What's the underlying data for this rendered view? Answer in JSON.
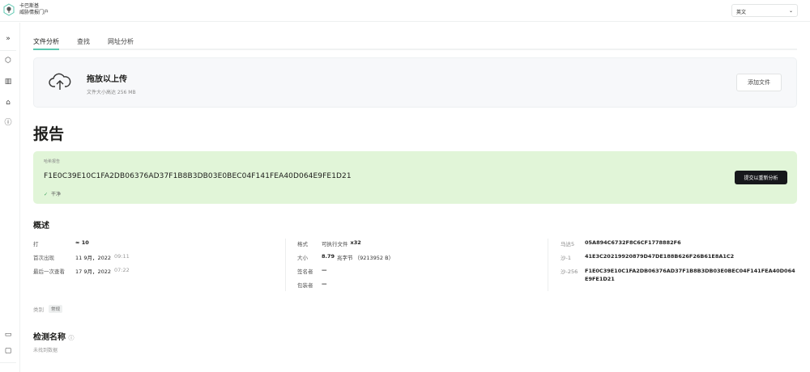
{
  "header": {
    "brand_line1": "卡巴斯基",
    "brand_line2": "威胁情报门户",
    "language": "英文"
  },
  "tabs": [
    {
      "label": "文件分析",
      "active": true
    },
    {
      "label": "查找"
    },
    {
      "label": "网址分析"
    }
  ],
  "upload": {
    "title": "拖放以上传",
    "subtitle": "文件大小高达 256 MB",
    "add_button": "添加文件"
  },
  "report": {
    "heading": "报告",
    "hash_label": "哈希报告",
    "hash": "F1E0C39E10C1FA2DB06376AD37F1B8B3DB03E0BEC04F141FEA40D064E9FE1D21",
    "status": "干净",
    "resubmit_button": "提交以重新分析",
    "status_color": "#3ca05a"
  },
  "overview": {
    "heading": "概述",
    "col1": [
      {
        "k": "打",
        "v": "≈ 10",
        "t": ""
      },
      {
        "k": "首次出现",
        "v": "11 9月，2022",
        "t": "09:11"
      },
      {
        "k": "最后一次查看",
        "v": "17 9月，2022",
        "t": "07:22"
      }
    ],
    "col2": [
      {
        "k": "格式",
        "pre": "可执行文件",
        "v": "x32"
      },
      {
        "k": "大小",
        "v": "8.79",
        "pre": "兆字节 （9213952 B）"
      },
      {
        "k": "签名者",
        "v": "—"
      },
      {
        "k": "包装者",
        "v": "—"
      }
    ],
    "col3": [
      {
        "k": "马达5",
        "v": "05A894C6732F8C6CF1778882F6"
      },
      {
        "k": "沙-1",
        "v": "41E3C20219920879D47DE188B626F26B61E8A1C2"
      },
      {
        "k": "沙-256",
        "v": "F1E0C39E10C1FA2DB06376AD37F1B8B3DB03E0BEC04F141FEA40D064",
        "v2": "E9FE1D21"
      }
    ],
    "category_label": "类别",
    "category": "常规"
  },
  "detection": {
    "heading": "检测名称",
    "empty": "未找到数据"
  }
}
